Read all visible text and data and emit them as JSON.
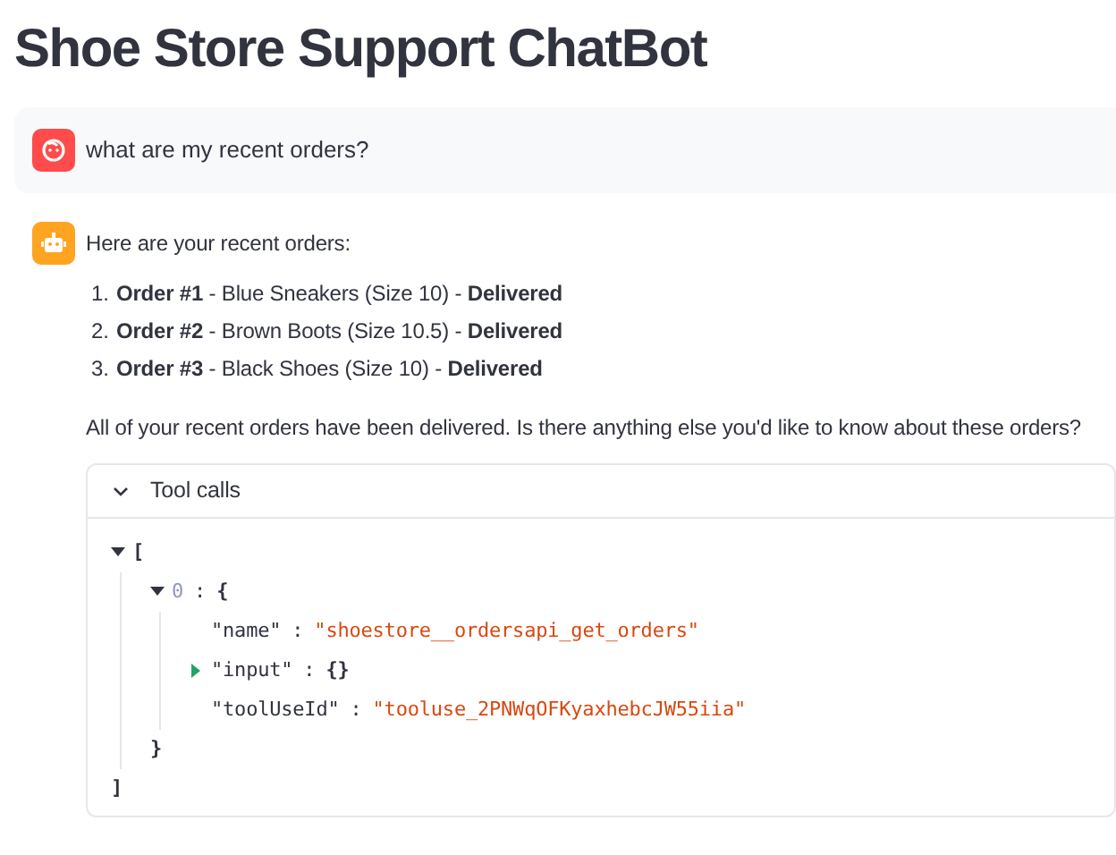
{
  "title": "Shoe Store Support ChatBot",
  "messages": [
    {
      "kind": "user",
      "text": "what are my recent orders?"
    },
    {
      "kind": "assistant",
      "intro": "Here are your recent orders:",
      "items": [
        {
          "number": "1.",
          "text": "**Order #1** - Blue Sneakers (Size 10) - **Delivered**"
        },
        {
          "number": "2.",
          "text": "**Order #2** - Brown Boots (Size 10.5) - **Delivered**"
        },
        {
          "number": "3.",
          "text": "**Order #3** - Black Shoes (Size 10) - **Delivered**"
        }
      ],
      "outro": "All of your recent orders have been delivered. Is there anything else you'd like to know about these orders?",
      "tool_calls": {
        "label": "Tool calls",
        "expanded": true,
        "tree": {
          "open": "[",
          "close": "]",
          "expanded": true,
          "children": [
            {
              "key": "0",
              "separator": ":",
              "open": "{",
              "close": "}",
              "expanded": true,
              "children": [
                {
                  "key": "\"name\"",
                  "separator": ":",
                  "value": "\"shoestore__ordersapi_get_orders\""
                },
                {
                  "key": "\"input\"",
                  "separator": ":",
                  "value": "{}",
                  "expanded": false
                },
                {
                  "key": "\"toolUseId\"",
                  "separator": ":",
                  "value": "\"tooluse_2PNWqOFKyaxhebcJW55iia\""
                }
              ]
            }
          ]
        }
      }
    }
  ]
}
